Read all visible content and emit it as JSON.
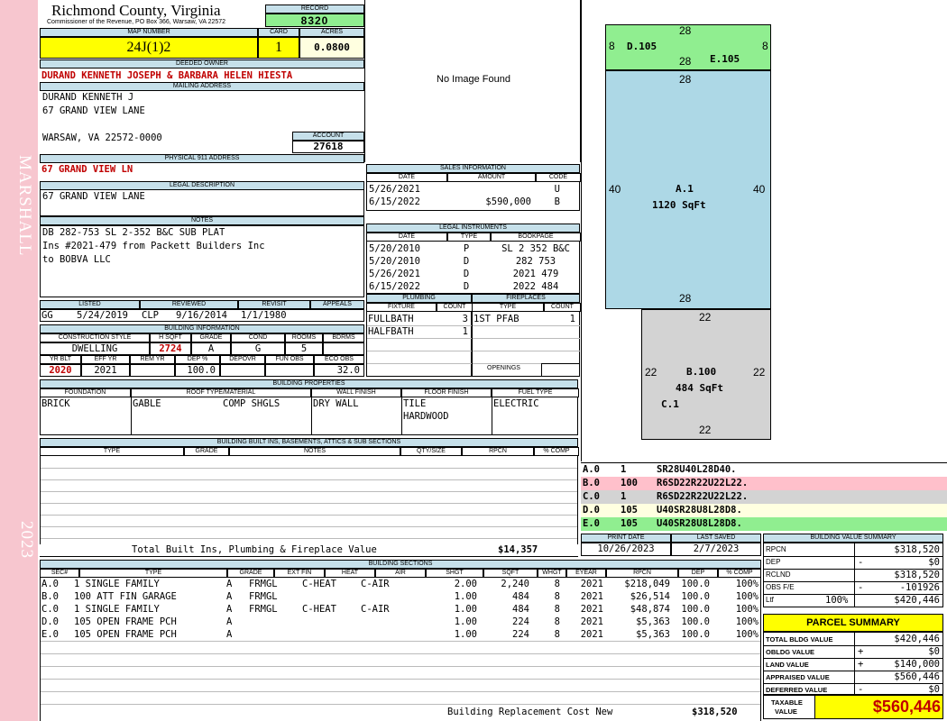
{
  "sidebar": {
    "name": "MARSHALL",
    "year": "2023"
  },
  "header": {
    "county": "Richmond County, Virginia",
    "commissioner": "Commissioner of the Revenue, PO Box 366, Warsaw, VA 22572",
    "record_label": "RECORD",
    "record": "8320"
  },
  "map": {
    "map_label": "MAP NUMBER",
    "map_number": "24J(1)2",
    "card_label": "CARD",
    "card": "1",
    "acres_label": "ACRES",
    "acres": "0.0800"
  },
  "owner": {
    "deeded_label": "DEEDED OWNER",
    "deeded_owner": "DURAND KENNETH JOSEPH & BARBARA HELEN HIESTA",
    "mailing_label": "MAILING ADDRESS",
    "mail_line1": "DURAND KENNETH J",
    "mail_line2": "67 GRAND VIEW LANE",
    "mail_line3": "WARSAW, VA 22572-0000",
    "account_label": "ACCOUNT",
    "account": "27618"
  },
  "physical": {
    "label": "PHYSICAL 911 ADDRESS",
    "address": "67 GRAND VIEW LN"
  },
  "legal": {
    "label": "LEGAL DESCRIPTION",
    "text": "67 GRAND VIEW LANE"
  },
  "notes": {
    "label": "NOTES",
    "line1": "DB 282-753 SL 2-352 B&C SUB PLAT",
    "line2": "Ins #2021-479 from Packett Builders Inc",
    "line3": "to BOBVA LLC"
  },
  "listed": {
    "listed_label": "LISTED",
    "reviewed_label": "REVIEWED",
    "revisit_label": "REVISIT",
    "appeals_label": "APPEALS",
    "listed_by": "GG",
    "listed_date": "5/24/2019",
    "reviewed_by": "CLP",
    "reviewed_date": "9/16/2014",
    "revisit": "1/1/1980"
  },
  "building_info": {
    "label": "BUILDING INFORMATION",
    "h_style": "CONSTRUCTION STYLE",
    "h_sqft": "H SQFT",
    "h_grade": "GRADE",
    "h_cond": "COND",
    "h_rooms": "ROOMS",
    "h_bdrms": "BDRMS",
    "style": "DWELLING",
    "sqft": "2724",
    "grade": "A",
    "cond": "G",
    "rooms": "5",
    "h_yrblt": "YR BLT",
    "h_effyr": "EFF YR",
    "h_remyr": "REM YR",
    "h_dep": "DEP %",
    "h_depovr": "DEPOVR",
    "h_funobs": "FUN OBS",
    "h_ecoobs": "ECO OBS",
    "yrblt": "2020",
    "effyr": "2021",
    "dep": "100.0",
    "ecoobs": "32.0"
  },
  "image": {
    "text": "No Image Found"
  },
  "sales": {
    "label": "SALES INFORMATION",
    "h_date": "DATE",
    "h_amount": "AMOUNT",
    "h_code": "CODE",
    "rows": [
      {
        "date": "5/26/2021",
        "amount": "",
        "code": "U"
      },
      {
        "date": "6/15/2022",
        "amount": "$590,000",
        "code": "B"
      }
    ]
  },
  "instruments": {
    "label": "LEGAL INSTRUMENTS",
    "h_date": "DATE",
    "h_type": "TYPE",
    "h_book": "BOOKPAGE",
    "rows": [
      {
        "date": "5/20/2010",
        "type": "P",
        "book": "SL 2 352 B&C"
      },
      {
        "date": "5/20/2010",
        "type": "D",
        "book": "282 753"
      },
      {
        "date": "5/26/2021",
        "type": "D",
        "book": "2021 479"
      },
      {
        "date": "6/15/2022",
        "type": "D",
        "book": "2022 484"
      }
    ]
  },
  "plumbing": {
    "label": "PLUMBING",
    "h_fixture": "FIXTURE",
    "h_count": "COUNT",
    "rows": [
      {
        "fixture": "FULLBATH",
        "count": "3"
      },
      {
        "fixture": "HALFBATH",
        "count": "1"
      }
    ]
  },
  "fireplaces": {
    "label": "FIREPLACES",
    "h_type": "TYPE",
    "h_count": "COUNT",
    "rows": [
      {
        "type": "1ST PFAB",
        "count": "1"
      }
    ],
    "openings_label": "OPENINGS"
  },
  "properties": {
    "label": "BUILDING PROPERTIES",
    "h_foundation": "FOUNDATION",
    "h_roof": "ROOF TYPE/MATERIAL",
    "h_wall": "WALL FINISH",
    "h_floor": "FLOOR FINISH",
    "h_fuel": "FUEL TYPE",
    "foundation": "BRICK",
    "roof_type": "GABLE",
    "roof_mat": "COMP SHGLS",
    "wall": "DRY WALL",
    "floor1": "TILE",
    "floor2": "HARDWOOD",
    "fuel": "ELECTRIC"
  },
  "builtins": {
    "label": "BUILDING BUILT INS, BASEMENTS, ATTICS & SUB SECTIONS",
    "h_type": "TYPE",
    "h_grade": "GRADE",
    "h_notes": "NOTES",
    "h_qty": "QTY/SIZE",
    "h_rpcn": "RPCN",
    "h_comp": "% COMP",
    "total_label": "Total Built Ins, Plumbing & Fireplace Value",
    "total": "$14,357"
  },
  "sketch": {
    "d_label": "D.105",
    "e_label": "E.105",
    "a_label": "A.1",
    "a_area": "1120 SqFt",
    "b_label": "B.100",
    "b_area": "484 SqFt",
    "c_label": "C.1",
    "d_top": "28",
    "d_left": "8",
    "d_bottom": "28",
    "e_right": "8",
    "a_top": "28",
    "a_left": "40",
    "a_right": "40",
    "a_bottom": "28",
    "b_top": "22",
    "b_left": "22",
    "b_right": "22",
    "b_bottom": "22"
  },
  "vectors": [
    {
      "id": "A.0",
      "code": "1",
      "vec": "SR28U40L28D40.",
      "color": "#ffffff"
    },
    {
      "id": "B.0",
      "code": "100",
      "vec": "R6SD22R22U22L22.",
      "color": "#ffc0cb"
    },
    {
      "id": "C.0",
      "code": "1",
      "vec": "R6SD22R22U22L22.",
      "color": "#d3d3d3"
    },
    {
      "id": "D.0",
      "code": "105",
      "vec": "U40SR28U8L28D8.",
      "color": "#ffffe0"
    },
    {
      "id": "E.0",
      "code": "105",
      "vec": "U40SR28U8L28D8.",
      "color": "#90ee90"
    }
  ],
  "print": {
    "print_label": "PRINT DATE",
    "saved_label": "LAST SAVED",
    "print_date": "10/26/2023",
    "saved_date": "2/7/2023"
  },
  "sections": {
    "label": "BUILDING SECTIONS",
    "h_sec": "SEC#",
    "h_type": "TYPE",
    "h_grade": "GRADE",
    "h_extfin": "EXT FIN",
    "h_heat": "HEAT",
    "h_air": "AIR",
    "h_shgt": "SHGT",
    "h_sqft": "SQFT",
    "h_whgt": "WHGT",
    "h_eyear": "EYEAR",
    "h_rpcn": "RPCN",
    "h_dep": "DEP",
    "h_comp": "% COMP",
    "rows": [
      {
        "sec": "A.0",
        "type": "1 SINGLE FAMILY",
        "grade": "A",
        "ext": "FRMGL",
        "heat": "C-HEAT",
        "air": "C-AIR",
        "shgt": "2.00",
        "sqft": "2,240",
        "whgt": "8",
        "eyear": "2021",
        "rpcn": "$218,049",
        "dep": "100.0",
        "comp": "100%"
      },
      {
        "sec": "B.0",
        "type": "100 ATT FIN GARAGE",
        "grade": "A",
        "ext": "FRMGL",
        "heat": "",
        "air": "",
        "shgt": "1.00",
        "sqft": "484",
        "whgt": "8",
        "eyear": "2021",
        "rpcn": "$26,514",
        "dep": "100.0",
        "comp": "100%"
      },
      {
        "sec": "C.0",
        "type": "1 SINGLE FAMILY",
        "grade": "A",
        "ext": "FRMGL",
        "heat": "C-HEAT",
        "air": "C-AIR",
        "shgt": "1.00",
        "sqft": "484",
        "whgt": "8",
        "eyear": "2021",
        "rpcn": "$48,874",
        "dep": "100.0",
        "comp": "100%"
      },
      {
        "sec": "D.0",
        "type": "105 OPEN FRAME PCH",
        "grade": "A",
        "ext": "",
        "heat": "",
        "air": "",
        "shgt": "1.00",
        "sqft": "224",
        "whgt": "8",
        "eyear": "2021",
        "rpcn": "$5,363",
        "dep": "100.0",
        "comp": "100%"
      },
      {
        "sec": "E.0",
        "type": "105 OPEN FRAME PCH",
        "grade": "A",
        "ext": "",
        "heat": "",
        "air": "",
        "shgt": "1.00",
        "sqft": "224",
        "whgt": "8",
        "eyear": "2021",
        "rpcn": "$5,363",
        "dep": "100.0",
        "comp": "100%"
      }
    ],
    "total_label": "Building Replacement Cost New",
    "total": "$318,520"
  },
  "value_summary": {
    "label": "BUILDING VALUE SUMMARY",
    "rpcn_label": "RPCN",
    "rpcn": "$318,520",
    "dep_label": "DEP",
    "dep_sign": "-",
    "dep": "$0",
    "rclnd_label": "RCLND",
    "rclnd": "$318,520",
    "obs_label": "OBS F/E",
    "obs_sign": "-",
    "obs": "-101926",
    "ltf_label": "Ltf",
    "ltf_pct": "100%",
    "ltf": "$420,446"
  },
  "parcel": {
    "label": "PARCEL SUMMARY",
    "bldg_label": "TOTAL BLDG VALUE",
    "bldg": "$420,446",
    "obldg_label": "OBLDG VALUE",
    "obldg_sign": "+",
    "obldg": "$0",
    "land_label": "LAND VALUE",
    "land_sign": "+",
    "land": "$140,000",
    "appraised_label": "APPRAISED VALUE",
    "appraised": "$560,446",
    "deferred_label": "DEFERRED VALUE",
    "deferred_sign": "-",
    "deferred": "$0",
    "taxable_label1": "TAXABLE",
    "taxable_label2": "VALUE",
    "taxable": "$560,446"
  }
}
